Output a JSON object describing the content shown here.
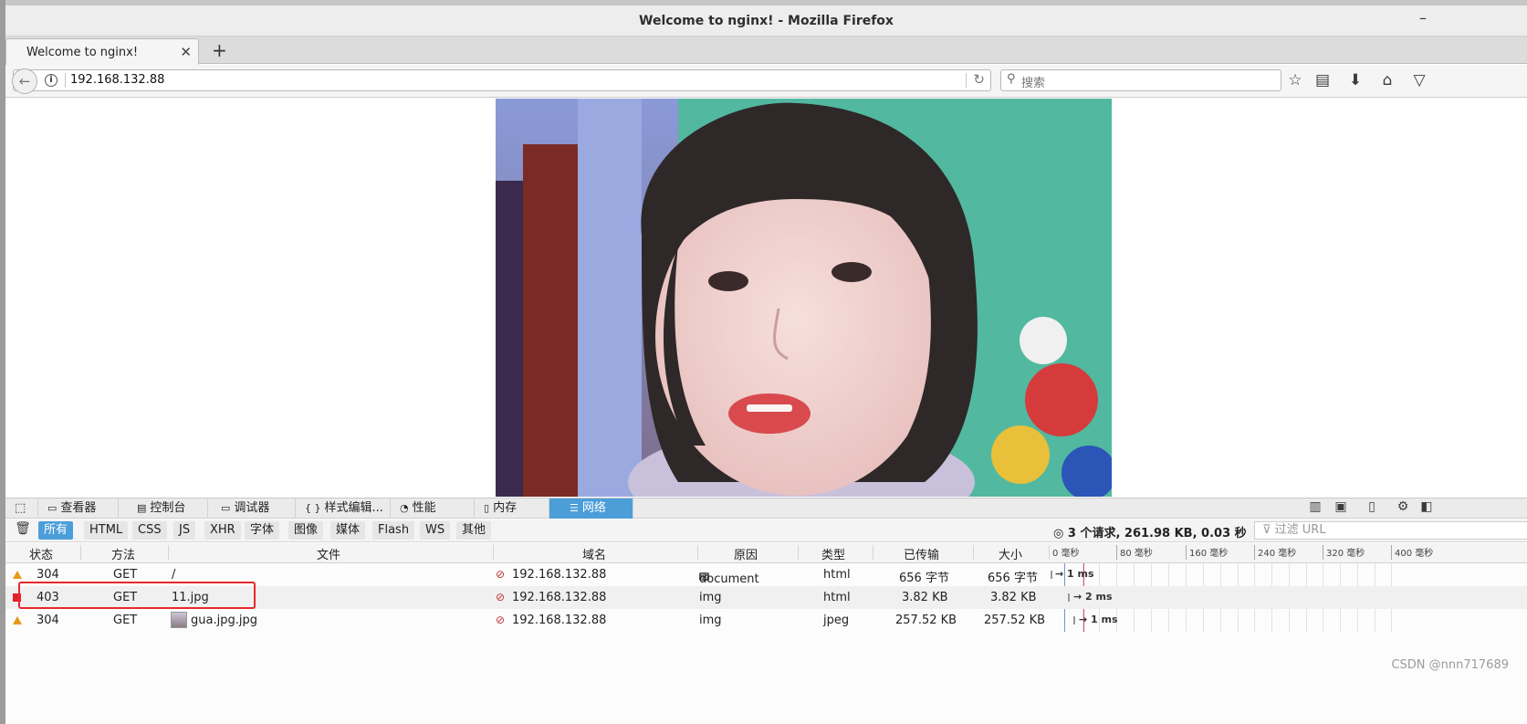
{
  "window": {
    "title": "Welcome to nginx! - Mozilla Firefox",
    "minimize": "–",
    "maximize": "▭"
  },
  "tab": {
    "label": "Welcome to nginx!",
    "close": "✕",
    "new_tab": "+"
  },
  "nav": {
    "back": "←",
    "url": "192.168.132.88",
    "reload": "↻",
    "search_placeholder": "搜索",
    "toolbar_icons": [
      "bookmark-star-icon",
      "reading-list-icon",
      "download-icon",
      "home-icon",
      "pocket-icon"
    ]
  },
  "devtools": {
    "tabs": [
      {
        "label": "查看器",
        "icon": "inspector-icon"
      },
      {
        "label": "控制台",
        "icon": "console-icon"
      },
      {
        "label": "调试器",
        "icon": "debugger-icon"
      },
      {
        "label": "样式编辑...",
        "icon": "style-editor-icon"
      },
      {
        "label": "性能",
        "icon": "performance-icon"
      },
      {
        "label": "内存",
        "icon": "memory-icon"
      },
      {
        "label": "网络",
        "icon": "network-icon",
        "active": true
      }
    ],
    "filters": [
      "所有",
      "HTML",
      "CSS",
      "JS",
      "XHR",
      "字体",
      "图像",
      "媒体",
      "Flash",
      "WS",
      "其他"
    ],
    "summary": "3 个请求, 261.98 KB, 0.03 秒",
    "filter_url_placeholder": "过滤 URL",
    "columns": [
      "状态",
      "方法",
      "文件",
      "域名",
      "原因",
      "类型",
      "已传输",
      "大小"
    ],
    "timeline_ticks": [
      "0 毫秒",
      "80 毫秒",
      "160 毫秒",
      "240 毫秒",
      "320 毫秒",
      "400 毫秒"
    ],
    "requests": [
      {
        "status": "304",
        "method": "GET",
        "file": "/",
        "domain": "192.168.132.88",
        "cause": "document",
        "type": "html",
        "transferred": "656 字节",
        "size": "656 字节",
        "timing": "→ 1 ms",
        "status_color": "#e69a1a"
      },
      {
        "status": "403",
        "method": "GET",
        "file": "11.jpg",
        "domain": "192.168.132.88",
        "cause": "img",
        "type": "html",
        "transferred": "3.82 KB",
        "size": "3.82 KB",
        "timing": "→ 2 ms",
        "status_color": "#e0202a"
      },
      {
        "status": "304",
        "method": "GET",
        "file": "gua.jpg.jpg",
        "domain": "192.168.132.88",
        "cause": "img",
        "type": "jpeg",
        "transferred": "257.52 KB",
        "size": "257.52 KB",
        "timing": "→ 1 ms",
        "status_color": "#e69a1a"
      }
    ],
    "js_badge": "JS"
  },
  "watermark": "CSDN @nnn717689"
}
